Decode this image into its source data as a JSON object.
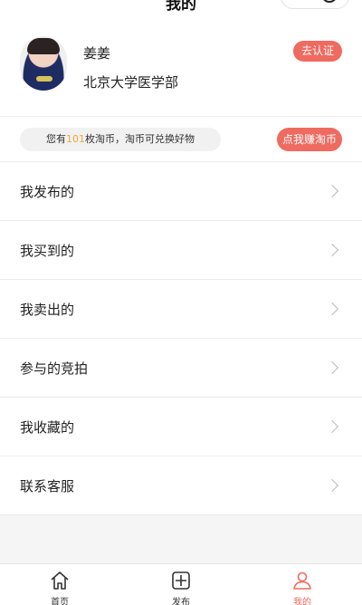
{
  "navbar": {
    "title": "我的"
  },
  "profile": {
    "name": "姜姜",
    "school": "北京大学医学部",
    "verify_button": "去认证"
  },
  "coins": {
    "prefix": "您有",
    "count": "101",
    "suffix": "枚淘币，淘币可兑换好物",
    "earn_button": "点我赚淘币"
  },
  "menu": {
    "items": [
      {
        "label": "我发布的"
      },
      {
        "label": "我买到的"
      },
      {
        "label": "我卖出的"
      },
      {
        "label": "参与的竞拍"
      },
      {
        "label": "我收藏的"
      },
      {
        "label": "联系客服"
      }
    ]
  },
  "tabbar": {
    "tabs": [
      {
        "label": "首页",
        "icon": "home-icon"
      },
      {
        "label": "发布",
        "icon": "publish-icon"
      },
      {
        "label": "我的",
        "icon": "user-icon"
      }
    ],
    "active_color": "#ef6a5f"
  },
  "colors": {
    "accent": "#ef6a5f",
    "coin_highlight": "#e9a83c"
  }
}
